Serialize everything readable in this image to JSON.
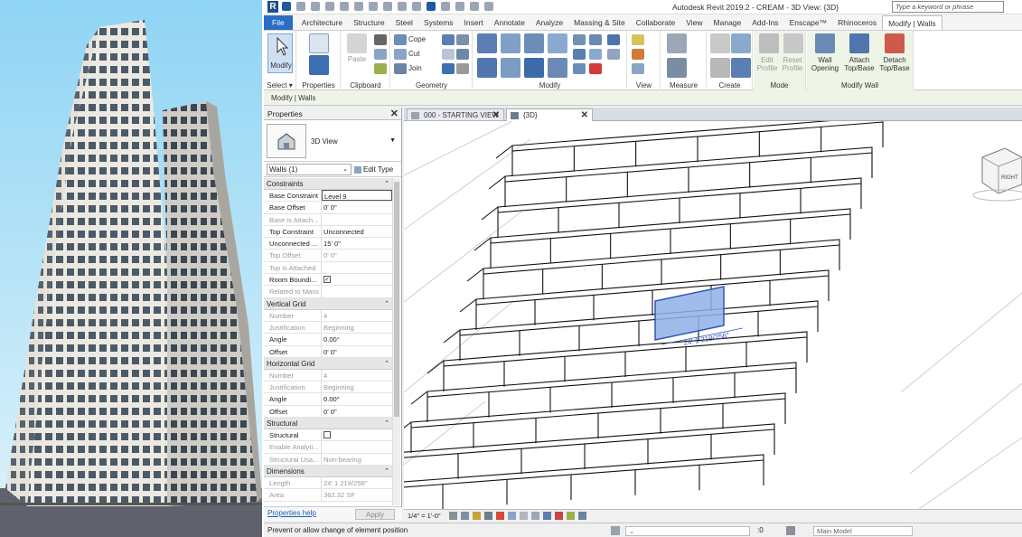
{
  "app": {
    "title": "Autodesk Revit 2019.2 - CREAM - 3D View: {3D}",
    "search_placeholder": "Type a keyword or phrase",
    "logo_letter": "R",
    "accent": "#2b6cc4",
    "context_accent": "#eef5e6"
  },
  "tabs": [
    "File",
    "Architecture",
    "Structure",
    "Steel",
    "Systems",
    "Insert",
    "Annotate",
    "Analyze",
    "Massing & Site",
    "Collaborate",
    "View",
    "Manage",
    "Add-Ins",
    "Enscape™",
    "Rhinoceros",
    "Modify | Walls"
  ],
  "ribbon": {
    "modify_label": "Modify",
    "select_label": "Select ▾",
    "properties_label": "Properties",
    "clipboard_label": "Clipboard",
    "paste_label": "Paste",
    "cope_label": "Cope",
    "cut_label": "Cut",
    "join_label": "Join",
    "geometry_label": "Geometry",
    "modify_panel_label": "Modify",
    "view_label": "View",
    "measure_label": "Measure",
    "create_label": "Create",
    "mode_label": "Mode",
    "modify_wall_label": "Modify Wall",
    "edit_profile": "Edit Profile",
    "reset_profile": "Reset Profile",
    "wall_opening": "Wall Opening",
    "attach_top_base": "Attach Top/Base",
    "detach_top_base": "Detach Top/Base"
  },
  "context_bar": "Modify | Walls",
  "properties": {
    "title": "Properties",
    "type_name": "3D View",
    "filter": "Walls (1)",
    "edit_type": "Edit Type",
    "help_link": "Properties help",
    "apply": "Apply",
    "sections": [
      {
        "name": "Constraints",
        "rows": [
          {
            "k": "Base Constraint",
            "v": "Level 9",
            "state": "sel"
          },
          {
            "k": "Base Offset",
            "v": "0' 0\"",
            "state": ""
          },
          {
            "k": "Base is Attach...",
            "v": "",
            "state": "dis"
          },
          {
            "k": "Top Constraint",
            "v": "Unconnected",
            "state": ""
          },
          {
            "k": "Unconnected ...",
            "v": "15' 0\"",
            "state": ""
          },
          {
            "k": "Top Offset",
            "v": "0' 0\"",
            "state": "dis"
          },
          {
            "k": "Top is Attached",
            "v": "",
            "state": "dis"
          },
          {
            "k": "Room Boundi...",
            "v": "✓",
            "state": "chk"
          },
          {
            "k": "Related to Mass",
            "v": "",
            "state": "dis"
          }
        ]
      },
      {
        "name": "Vertical Grid",
        "rows": [
          {
            "k": "Number",
            "v": "4",
            "state": "dis"
          },
          {
            "k": "Justification",
            "v": "Beginning",
            "state": "dis"
          },
          {
            "k": "Angle",
            "v": "0.00°",
            "state": ""
          },
          {
            "k": "Offset",
            "v": "0' 0\"",
            "state": ""
          }
        ]
      },
      {
        "name": "Horizontal Grid",
        "rows": [
          {
            "k": "Number",
            "v": "4",
            "state": "dis"
          },
          {
            "k": "Justification",
            "v": "Beginning",
            "state": "dis"
          },
          {
            "k": "Angle",
            "v": "0.00°",
            "state": ""
          },
          {
            "k": "Offset",
            "v": "0' 0\"",
            "state": ""
          }
        ]
      },
      {
        "name": "Structural",
        "rows": [
          {
            "k": "Structural",
            "v": "",
            "state": "chk0"
          },
          {
            "k": "Enable Analyti...",
            "v": "",
            "state": "dis"
          },
          {
            "k": "Structural Usa...",
            "v": "Non-bearing",
            "state": "dis"
          }
        ]
      },
      {
        "name": "Dimensions",
        "rows": [
          {
            "k": "Length",
            "v": "24' 1 219/256\"",
            "state": "dis"
          },
          {
            "k": "Area",
            "v": "362.32 SF",
            "state": "dis"
          }
        ]
      }
    ]
  },
  "view_tabs": [
    {
      "label": "000 - STARTING VIEW"
    },
    {
      "label": "{3D}"
    }
  ],
  "canvas": {
    "dimension_label": "24' 1 219/256\"",
    "viewcube_label": "RIGHT"
  },
  "view_control": {
    "scale": "1/4\" = 1'-0\""
  },
  "status": {
    "message": "Prevent or allow change of element position",
    "zero": ":0",
    "model": "Main Model"
  }
}
